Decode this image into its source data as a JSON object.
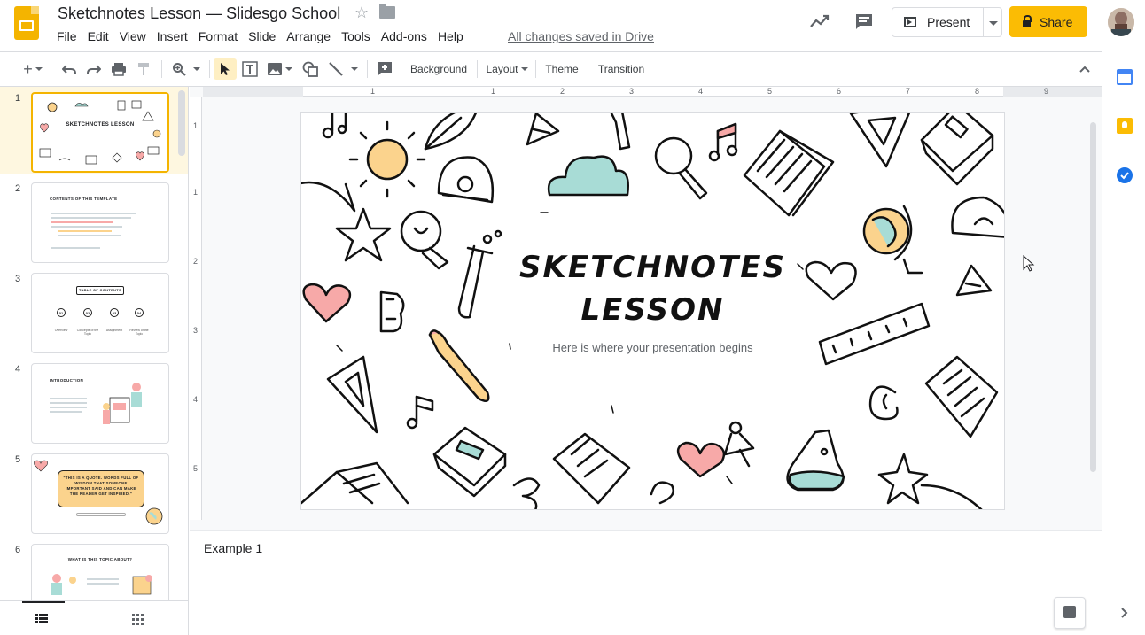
{
  "header": {
    "doc_title": "Sketchnotes Lesson — Slidesgo School",
    "menu": [
      "File",
      "Edit",
      "View",
      "Insert",
      "Format",
      "Slide",
      "Arrange",
      "Tools",
      "Add-ons",
      "Help"
    ],
    "save_status": "All changes saved in Drive",
    "present_label": "Present",
    "share_label": "Share"
  },
  "toolbar": {
    "background_label": "Background",
    "layout_label": "Layout",
    "theme_label": "Theme",
    "transition_label": "Transition"
  },
  "ruler": {
    "h_ticks": [
      "1",
      "1",
      "2",
      "3",
      "4",
      "5",
      "6",
      "7",
      "8",
      "9"
    ],
    "v_ticks": [
      "1",
      "1",
      "2",
      "3",
      "4",
      "5"
    ]
  },
  "filmstrip": {
    "slides": [
      {
        "number": "1",
        "title": "SKETCHNOTES LESSON"
      },
      {
        "number": "2",
        "title": "CONTENTS OF THIS TEMPLATE"
      },
      {
        "number": "3",
        "title": "TABLE OF CONTENTS"
      },
      {
        "number": "4",
        "title": "INTRODUCTION"
      },
      {
        "number": "5",
        "title": "\"THIS IS A QUOTE. WORDS FULL OF WISDOM THAT SOMEONE IMPORTANT SAID AND CAN MAKE THE READER GET INSPIRED.\""
      },
      {
        "number": "6",
        "title": "WHAT IS THIS TOPIC ABOUT?"
      }
    ],
    "slide3_items": [
      "01",
      "02",
      "03",
      "04"
    ],
    "slide3_labels": [
      "Overview",
      "Concepts of the Topic",
      "Assignment",
      "Review of the Topic"
    ]
  },
  "slide": {
    "title_line1": "SKETCHNOTES",
    "title_line2": "LESSON",
    "subtitle": "Here is where your presentation begins"
  },
  "notes": {
    "text": "Example 1"
  },
  "colors": {
    "accent_yellow": "#fbbc04",
    "selected_row": "#fef7e0",
    "doodle_sun": "#fbd38d",
    "doodle_cloud": "#a8dcd6",
    "doodle_heart": "#f7a9a8"
  }
}
